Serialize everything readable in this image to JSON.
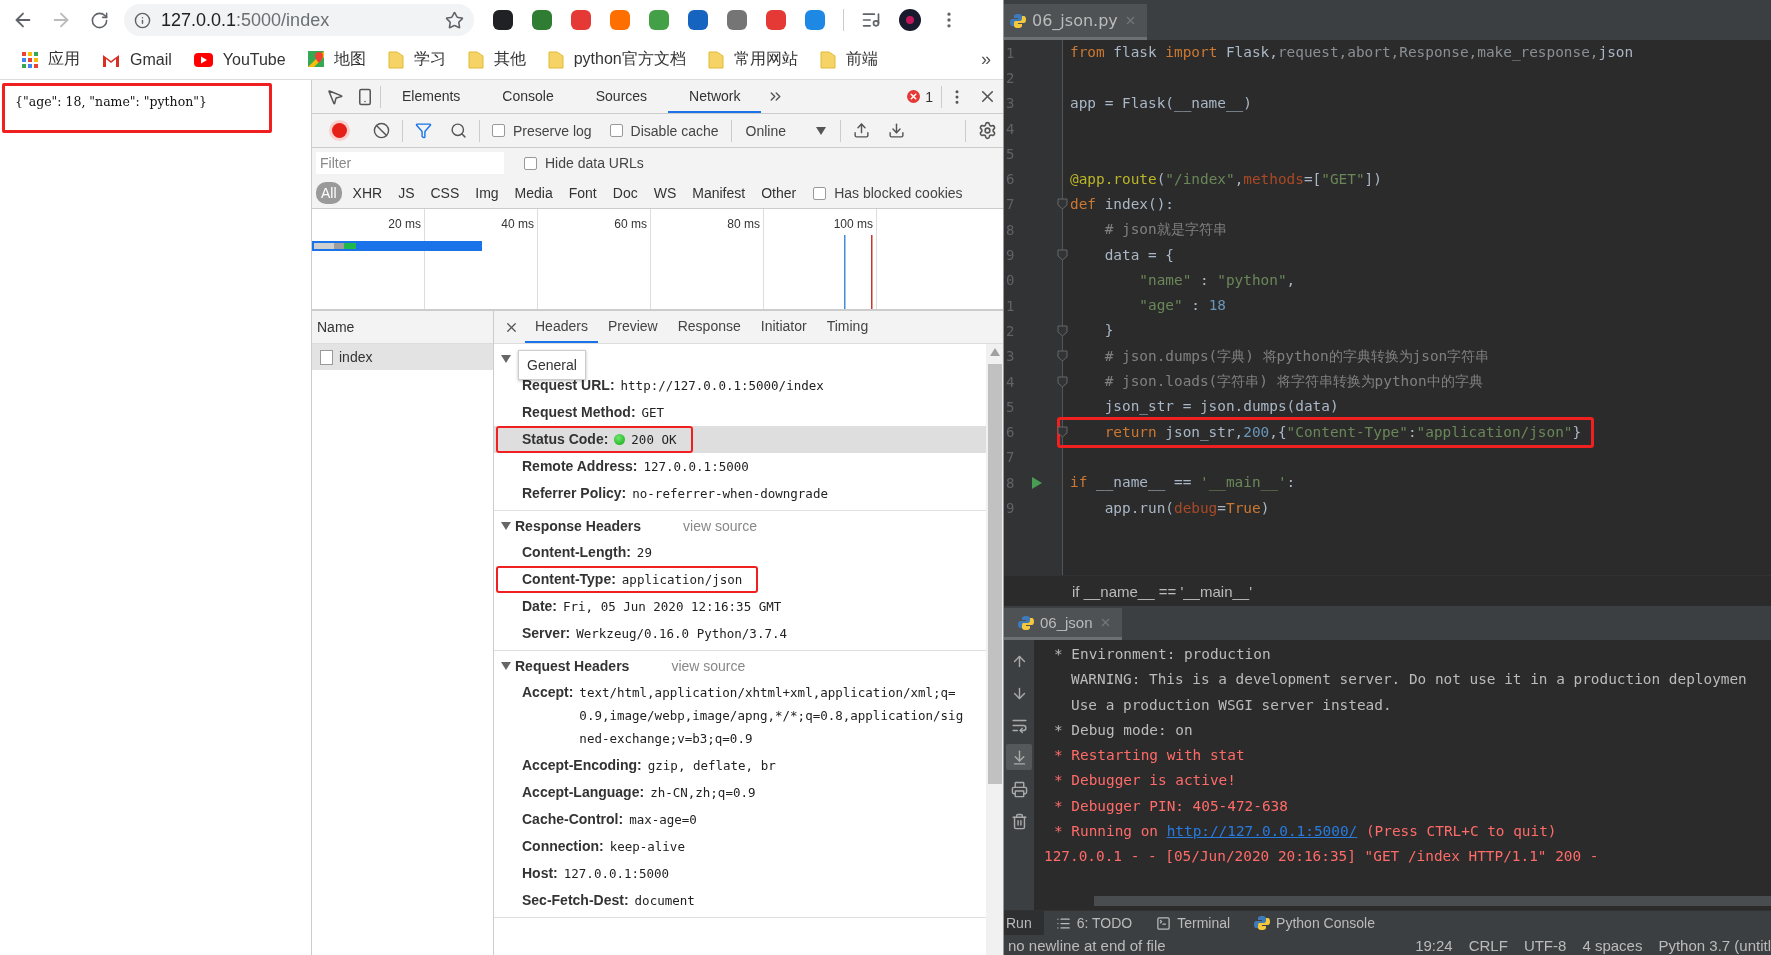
{
  "browser": {
    "nav": [
      {
        "kind": "back",
        "disabled": false
      },
      {
        "kind": "forward",
        "disabled": true
      },
      {
        "kind": "reload",
        "disabled": false
      }
    ],
    "address": {
      "host": "127.0.0.1",
      "path": ":5000/index"
    },
    "extensions": [
      {
        "color": "#202124"
      },
      {
        "color": "#2e7d32"
      },
      {
        "color": "#e53935"
      },
      {
        "color": "#ff6f00"
      },
      {
        "color": "#43a047"
      },
      {
        "color": "#1565c0"
      },
      {
        "color": "#757575"
      },
      {
        "color": "#e53935"
      },
      {
        "color": "#1e88e5"
      }
    ],
    "bookmarks": [
      {
        "kind": "apps",
        "label": "应用"
      },
      {
        "kind": "gmail",
        "label": "Gmail"
      },
      {
        "kind": "youtube",
        "label": "YouTube"
      },
      {
        "kind": "maps",
        "label": "地图"
      },
      {
        "kind": "folder",
        "label": "学习"
      },
      {
        "kind": "folder",
        "label": "其他"
      },
      {
        "kind": "folder",
        "label": "python官方文档"
      },
      {
        "kind": "folder",
        "label": "常用网站"
      },
      {
        "kind": "folder",
        "label": "前端"
      }
    ],
    "bookmarks_more": "»"
  },
  "page": {
    "text": "{\"age\": 18, \"name\": \"python\"}",
    "highlighted": true
  },
  "devtools": {
    "tabs": [
      {
        "label": "Elements",
        "selected": false
      },
      {
        "label": "Console",
        "selected": false
      },
      {
        "label": "Sources",
        "selected": false
      },
      {
        "label": "Network",
        "selected": true
      }
    ],
    "error_count": "1",
    "toolbar": {
      "recording": true,
      "filter_active": true,
      "preserve_log": {
        "label": "Preserve log",
        "checked": false
      },
      "disable_cache": {
        "label": "Disable cache",
        "checked": false
      },
      "throttling": "Online"
    },
    "filter": {
      "placeholder": "Filter",
      "hide_data_urls": {
        "label": "Hide data URLs",
        "checked": false
      }
    },
    "types": [
      {
        "label": "All",
        "selected": true
      },
      {
        "label": "XHR",
        "selected": false
      },
      {
        "label": "JS",
        "selected": false
      },
      {
        "label": "CSS",
        "selected": false
      },
      {
        "label": "Img",
        "selected": false
      },
      {
        "label": "Media",
        "selected": false
      },
      {
        "label": "Font",
        "selected": false
      },
      {
        "label": "Doc",
        "selected": false
      },
      {
        "label": "WS",
        "selected": false
      },
      {
        "label": "Manifest",
        "selected": false
      },
      {
        "label": "Other",
        "selected": false
      }
    ],
    "has_blocked_cookies": {
      "label": "Has blocked cookies",
      "checked": false
    },
    "timeline": {
      "ticks": [
        "20 ms",
        "40 ms",
        "60 ms",
        "80 ms",
        "100 ms"
      ]
    },
    "requests": {
      "column": "Name",
      "rows": [
        {
          "name": "index",
          "selected": true
        }
      ]
    },
    "detail_tabs": [
      {
        "label": "Headers",
        "selected": true
      },
      {
        "label": "Preview",
        "selected": false
      },
      {
        "label": "Response",
        "selected": false
      },
      {
        "label": "Initiator",
        "selected": false
      },
      {
        "label": "Timing",
        "selected": false
      }
    ],
    "tooltip": "General",
    "sections": [
      {
        "expanded": true,
        "rows": [
          {
            "kind": "text",
            "name": "Request URL:",
            "value": "http://127.0.0.1:5000/index",
            "hovered": false,
            "highlighted": false
          },
          {
            "kind": "text",
            "name": "Request Method:",
            "value": "GET",
            "hovered": false,
            "highlighted": false
          },
          {
            "kind": "status",
            "name": "Status Code:",
            "value": "200 OK",
            "hovered": true,
            "highlighted": true
          },
          {
            "kind": "text",
            "name": "Remote Address:",
            "value": "127.0.0.1:5000",
            "hovered": false,
            "highlighted": false
          },
          {
            "kind": "text",
            "name": "Referrer Policy:",
            "value": "no-referrer-when-downgrade",
            "hovered": false,
            "highlighted": false
          }
        ]
      },
      {
        "expanded": true,
        "title": "Response Headers",
        "link": "view source",
        "rows": [
          {
            "kind": "text",
            "name": "Content-Length:",
            "value": "29",
            "hovered": false,
            "highlighted": false
          },
          {
            "kind": "text",
            "name": "Content-Type:",
            "value": "application/json",
            "hovered": false,
            "highlighted": true
          },
          {
            "kind": "text",
            "name": "Date:",
            "value": "Fri, 05 Jun 2020 12:16:35 GMT",
            "hovered": false,
            "highlighted": false
          },
          {
            "kind": "text",
            "name": "Server:",
            "value": "Werkzeug/0.16.0 Python/3.7.4",
            "hovered": false,
            "highlighted": false
          }
        ]
      },
      {
        "expanded": true,
        "title": "Request Headers",
        "link": "view source",
        "rows": [
          {
            "kind": "text",
            "name": "Accept:",
            "value": "text/html,application/xhtml+xml,application/xml;q=0.9,image/webp,image/apng,*/*;q=0.8,application/signed-exchange;v=b3;q=0.9",
            "hovered": false,
            "highlighted": false
          },
          {
            "kind": "text",
            "name": "Accept-Encoding:",
            "value": "gzip, deflate, br",
            "hovered": false,
            "highlighted": false
          },
          {
            "kind": "text",
            "name": "Accept-Language:",
            "value": "zh-CN,zh;q=0.9",
            "hovered": false,
            "highlighted": false
          },
          {
            "kind": "text",
            "name": "Cache-Control:",
            "value": "max-age=0",
            "hovered": false,
            "highlighted": false
          },
          {
            "kind": "text",
            "name": "Connection:",
            "value": "keep-alive",
            "hovered": false,
            "highlighted": false
          },
          {
            "kind": "text",
            "name": "Host:",
            "value": "127.0.0.1:5000",
            "hovered": false,
            "highlighted": false
          },
          {
            "kind": "text",
            "name": "Sec-Fetch-Dest:",
            "value": "document",
            "hovered": false,
            "highlighted": false
          }
        ]
      }
    ]
  },
  "ide": {
    "editor": {
      "tab": "06_json.py",
      "lines": [
        {
          "number": "1",
          "kind": "plain",
          "highlighted": false,
          "tokens": [
            {
              "kind": "kw",
              "text": "from"
            },
            {
              "kind": "plain",
              "text": " flask "
            },
            {
              "kind": "kw",
              "text": "import"
            },
            {
              "kind": "plain",
              "text": " Flask,"
            },
            {
              "kind": "unused",
              "text": "request,abort,Response,make_response,"
            },
            {
              "kind": "plain",
              "text": "json"
            }
          ]
        },
        {
          "number": "2",
          "kind": "plain",
          "highlighted": false
        },
        {
          "number": "3",
          "kind": "plain",
          "highlighted": false,
          "tokens": [
            {
              "kind": "plain",
              "text": "app = Flask(__name__)"
            }
          ]
        },
        {
          "number": "4",
          "kind": "plain",
          "highlighted": false
        },
        {
          "number": "5",
          "kind": "plain",
          "highlighted": false
        },
        {
          "number": "6",
          "kind": "plain",
          "highlighted": false,
          "tokens": [
            {
              "kind": "deco",
              "text": "@app.route"
            },
            {
              "kind": "plain",
              "text": "("
            },
            {
              "kind": "str",
              "text": "\"/index\""
            },
            {
              "kind": "plain",
              "text": ","
            },
            {
              "kind": "param",
              "text": "methods"
            },
            {
              "kind": "plain",
              "text": "=["
            },
            {
              "kind": "str",
              "text": "\"GET\""
            },
            {
              "kind": "plain",
              "text": "])"
            }
          ]
        },
        {
          "number": "7",
          "kind": "fold",
          "highlighted": false,
          "tokens": [
            {
              "kind": "kw",
              "text": "def"
            },
            {
              "kind": "plain",
              "text": " index():"
            }
          ]
        },
        {
          "number": "8",
          "kind": "plain",
          "highlighted": false,
          "tokens": [
            {
              "kind": "comment",
              "text": "    # json就是字符串"
            }
          ]
        },
        {
          "number": "9",
          "kind": "fold",
          "highlighted": false,
          "tokens": [
            {
              "kind": "plain",
              "text": "    data = {"
            }
          ]
        },
        {
          "number": "0",
          "kind": "plain",
          "highlighted": false,
          "tokens": [
            {
              "kind": "str",
              "text": "        \"name\""
            },
            {
              "kind": "plain",
              "text": " : "
            },
            {
              "kind": "str",
              "text": "\"python\""
            },
            {
              "kind": "plain",
              "text": ","
            }
          ]
        },
        {
          "number": "1",
          "kind": "plain",
          "highlighted": false,
          "tokens": [
            {
              "kind": "str",
              "text": "        \"age\""
            },
            {
              "kind": "plain",
              "text": " : "
            },
            {
              "kind": "num",
              "text": "18"
            }
          ]
        },
        {
          "number": "2",
          "kind": "fold",
          "highlighted": false,
          "tokens": [
            {
              "kind": "plain",
              "text": "    }"
            }
          ]
        },
        {
          "number": "3",
          "kind": "fold",
          "highlighted": false,
          "tokens": [
            {
              "kind": "comment",
              "text": "    # json.dumps(字典) 将python的字典转换为json字符串"
            }
          ]
        },
        {
          "number": "4",
          "kind": "fold",
          "highlighted": false,
          "tokens": [
            {
              "kind": "comment",
              "text": "    # json.loads(字符串) 将字符串转换为python中的字典"
            }
          ]
        },
        {
          "number": "5",
          "kind": "plain",
          "highlighted": false,
          "tokens": [
            {
              "kind": "plain",
              "text": "    json_str = json.dumps(data)"
            }
          ]
        },
        {
          "number": "6",
          "kind": "fold",
          "highlighted": true,
          "tokens": [
            {
              "kind": "kw",
              "text": "    return"
            },
            {
              "kind": "plain",
              "text": " json_str,"
            },
            {
              "kind": "num",
              "text": "200"
            },
            {
              "kind": "plain",
              "text": ",{"
            },
            {
              "kind": "str",
              "text": "\"Content-Type\""
            },
            {
              "kind": "plain",
              "text": ":"
            },
            {
              "kind": "str",
              "text": "\"application/json\""
            },
            {
              "kind": "plain",
              "text": "}"
            }
          ]
        },
        {
          "number": "7",
          "kind": "plain",
          "highlighted": false
        },
        {
          "number": "8",
          "kind": "run",
          "highlighted": false,
          "tokens": [
            {
              "kind": "kw",
              "text": "if"
            },
            {
              "kind": "plain",
              "text": " __name__ == "
            },
            {
              "kind": "str",
              "text": "'__main__'"
            },
            {
              "kind": "plain",
              "text": ":"
            }
          ]
        },
        {
          "number": "9",
          "kind": "plain",
          "highlighted": false,
          "tokens": [
            {
              "kind": "plain",
              "text": "    app.run("
            },
            {
              "kind": "param",
              "text": "debug"
            },
            {
              "kind": "plain",
              "text": "="
            },
            {
              "kind": "kw",
              "text": "True"
            },
            {
              "kind": "plain",
              "text": ")"
            }
          ]
        }
      ],
      "breadcrumb": "if __name__ == '__main__'"
    },
    "run": {
      "tab": "06_json",
      "tools": [
        {
          "kind": "up",
          "selected": false
        },
        {
          "kind": "down",
          "selected": false
        },
        {
          "kind": "wrap",
          "selected": false
        },
        {
          "kind": "scroll",
          "selected": true
        },
        {
          "kind": "print",
          "selected": false
        },
        {
          "kind": "trash",
          "selected": false
        }
      ],
      "lines": [
        {
          "kind": "info",
          "parts": [
            {
              "text": "* Environment: production",
              "link": false
            }
          ]
        },
        {
          "kind": "continuation",
          "parts": [
            {
              "text": "WARNING: This is a development server. Do not use it in a production deploymen",
              "link": false
            }
          ]
        },
        {
          "kind": "continuation",
          "parts": [
            {
              "text": "Use a production WSGI server instead.",
              "link": false
            }
          ]
        },
        {
          "kind": "info",
          "parts": [
            {
              "text": "* Debug mode: on",
              "link": false
            }
          ]
        },
        {
          "kind": "error",
          "parts": [
            {
              "text": "* Restarting with stat",
              "link": false
            }
          ]
        },
        {
          "kind": "error",
          "parts": [
            {
              "text": "* Debugger is active!",
              "link": false
            }
          ]
        },
        {
          "kind": "error",
          "parts": [
            {
              "text": "* Debugger PIN: 405-472-638",
              "link": false
            }
          ]
        },
        {
          "kind": "error",
          "parts": [
            {
              "text": "* Running on ",
              "link": false
            },
            {
              "text": "http://127.0.0.1:5000/",
              "link": true
            },
            {
              "text": " (Press CTRL+C to quit)",
              "link": false
            }
          ]
        },
        {
          "kind": "log",
          "parts": [
            {
              "text": "127.0.0.1 - - [05/Jun/2020 20:16:35] \"GET /index HTTP/1.1\" 200 -",
              "link": false
            }
          ]
        }
      ]
    },
    "tool_windows": [
      {
        "kind": "run",
        "label": "Run",
        "selected": true
      },
      {
        "kind": "todo",
        "label": "6: TODO",
        "selected": false
      },
      {
        "kind": "terminal",
        "label": "Terminal",
        "selected": false
      },
      {
        "kind": "python",
        "label": "Python Console",
        "selected": false
      }
    ],
    "status": {
      "message": "no newline at end of file",
      "items": [
        "19:24",
        "CRLF",
        "UTF-8",
        "4 spaces",
        "Python 3.7 (untitl"
      ]
    }
  }
}
